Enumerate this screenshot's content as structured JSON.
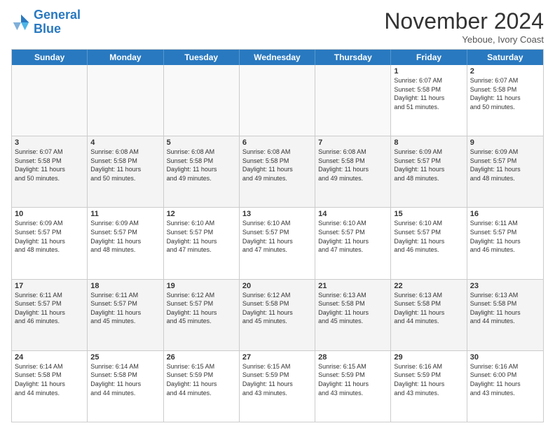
{
  "header": {
    "logo_line1": "General",
    "logo_line2": "Blue",
    "month": "November 2024",
    "location": "Yeboue, Ivory Coast"
  },
  "weekdays": [
    "Sunday",
    "Monday",
    "Tuesday",
    "Wednesday",
    "Thursday",
    "Friday",
    "Saturday"
  ],
  "rows": [
    [
      {
        "day": "",
        "info": "",
        "empty": true
      },
      {
        "day": "",
        "info": "",
        "empty": true
      },
      {
        "day": "",
        "info": "",
        "empty": true
      },
      {
        "day": "",
        "info": "",
        "empty": true
      },
      {
        "day": "",
        "info": "",
        "empty": true
      },
      {
        "day": "1",
        "info": "Sunrise: 6:07 AM\nSunset: 5:58 PM\nDaylight: 11 hours\nand 51 minutes.",
        "empty": false
      },
      {
        "day": "2",
        "info": "Sunrise: 6:07 AM\nSunset: 5:58 PM\nDaylight: 11 hours\nand 50 minutes.",
        "empty": false
      }
    ],
    [
      {
        "day": "3",
        "info": "Sunrise: 6:07 AM\nSunset: 5:58 PM\nDaylight: 11 hours\nand 50 minutes.",
        "empty": false
      },
      {
        "day": "4",
        "info": "Sunrise: 6:08 AM\nSunset: 5:58 PM\nDaylight: 11 hours\nand 50 minutes.",
        "empty": false
      },
      {
        "day": "5",
        "info": "Sunrise: 6:08 AM\nSunset: 5:58 PM\nDaylight: 11 hours\nand 49 minutes.",
        "empty": false
      },
      {
        "day": "6",
        "info": "Sunrise: 6:08 AM\nSunset: 5:58 PM\nDaylight: 11 hours\nand 49 minutes.",
        "empty": false
      },
      {
        "day": "7",
        "info": "Sunrise: 6:08 AM\nSunset: 5:58 PM\nDaylight: 11 hours\nand 49 minutes.",
        "empty": false
      },
      {
        "day": "8",
        "info": "Sunrise: 6:09 AM\nSunset: 5:57 PM\nDaylight: 11 hours\nand 48 minutes.",
        "empty": false
      },
      {
        "day": "9",
        "info": "Sunrise: 6:09 AM\nSunset: 5:57 PM\nDaylight: 11 hours\nand 48 minutes.",
        "empty": false
      }
    ],
    [
      {
        "day": "10",
        "info": "Sunrise: 6:09 AM\nSunset: 5:57 PM\nDaylight: 11 hours\nand 48 minutes.",
        "empty": false
      },
      {
        "day": "11",
        "info": "Sunrise: 6:09 AM\nSunset: 5:57 PM\nDaylight: 11 hours\nand 48 minutes.",
        "empty": false
      },
      {
        "day": "12",
        "info": "Sunrise: 6:10 AM\nSunset: 5:57 PM\nDaylight: 11 hours\nand 47 minutes.",
        "empty": false
      },
      {
        "day": "13",
        "info": "Sunrise: 6:10 AM\nSunset: 5:57 PM\nDaylight: 11 hours\nand 47 minutes.",
        "empty": false
      },
      {
        "day": "14",
        "info": "Sunrise: 6:10 AM\nSunset: 5:57 PM\nDaylight: 11 hours\nand 47 minutes.",
        "empty": false
      },
      {
        "day": "15",
        "info": "Sunrise: 6:10 AM\nSunset: 5:57 PM\nDaylight: 11 hours\nand 46 minutes.",
        "empty": false
      },
      {
        "day": "16",
        "info": "Sunrise: 6:11 AM\nSunset: 5:57 PM\nDaylight: 11 hours\nand 46 minutes.",
        "empty": false
      }
    ],
    [
      {
        "day": "17",
        "info": "Sunrise: 6:11 AM\nSunset: 5:57 PM\nDaylight: 11 hours\nand 46 minutes.",
        "empty": false
      },
      {
        "day": "18",
        "info": "Sunrise: 6:11 AM\nSunset: 5:57 PM\nDaylight: 11 hours\nand 45 minutes.",
        "empty": false
      },
      {
        "day": "19",
        "info": "Sunrise: 6:12 AM\nSunset: 5:57 PM\nDaylight: 11 hours\nand 45 minutes.",
        "empty": false
      },
      {
        "day": "20",
        "info": "Sunrise: 6:12 AM\nSunset: 5:58 PM\nDaylight: 11 hours\nand 45 minutes.",
        "empty": false
      },
      {
        "day": "21",
        "info": "Sunrise: 6:13 AM\nSunset: 5:58 PM\nDaylight: 11 hours\nand 45 minutes.",
        "empty": false
      },
      {
        "day": "22",
        "info": "Sunrise: 6:13 AM\nSunset: 5:58 PM\nDaylight: 11 hours\nand 44 minutes.",
        "empty": false
      },
      {
        "day": "23",
        "info": "Sunrise: 6:13 AM\nSunset: 5:58 PM\nDaylight: 11 hours\nand 44 minutes.",
        "empty": false
      }
    ],
    [
      {
        "day": "24",
        "info": "Sunrise: 6:14 AM\nSunset: 5:58 PM\nDaylight: 11 hours\nand 44 minutes.",
        "empty": false
      },
      {
        "day": "25",
        "info": "Sunrise: 6:14 AM\nSunset: 5:58 PM\nDaylight: 11 hours\nand 44 minutes.",
        "empty": false
      },
      {
        "day": "26",
        "info": "Sunrise: 6:15 AM\nSunset: 5:59 PM\nDaylight: 11 hours\nand 44 minutes.",
        "empty": false
      },
      {
        "day": "27",
        "info": "Sunrise: 6:15 AM\nSunset: 5:59 PM\nDaylight: 11 hours\nand 43 minutes.",
        "empty": false
      },
      {
        "day": "28",
        "info": "Sunrise: 6:15 AM\nSunset: 5:59 PM\nDaylight: 11 hours\nand 43 minutes.",
        "empty": false
      },
      {
        "day": "29",
        "info": "Sunrise: 6:16 AM\nSunset: 5:59 PM\nDaylight: 11 hours\nand 43 minutes.",
        "empty": false
      },
      {
        "day": "30",
        "info": "Sunrise: 6:16 AM\nSunset: 6:00 PM\nDaylight: 11 hours\nand 43 minutes.",
        "empty": false
      }
    ]
  ]
}
